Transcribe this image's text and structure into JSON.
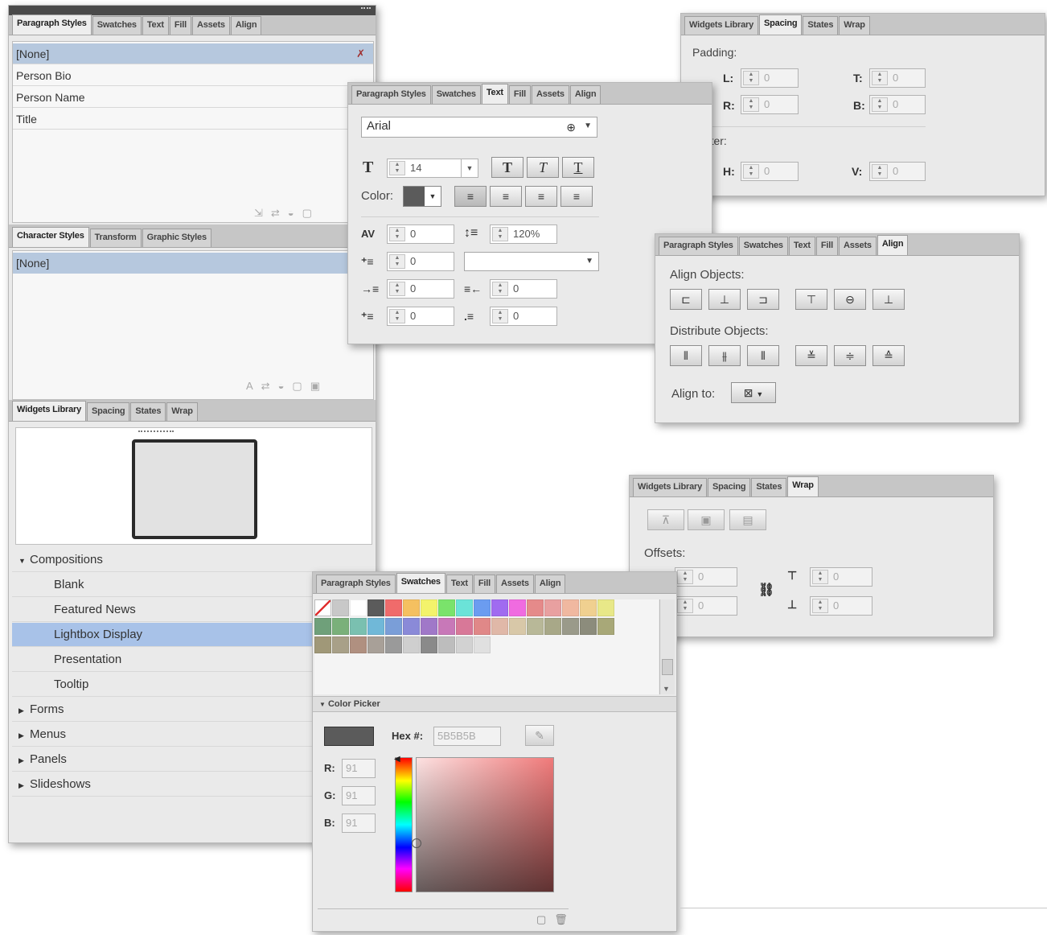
{
  "styles_panel": {
    "tabs": [
      "Paragraph Styles",
      "Swatches",
      "Text",
      "Fill",
      "Assets",
      "Align"
    ],
    "items": [
      "[None]",
      "Person Bio",
      "Person Name",
      "Title"
    ],
    "char_tabs": [
      "Character Styles",
      "Transform",
      "Graphic Styles"
    ],
    "char_items": [
      "[None]"
    ],
    "widget_tabs": [
      "Widgets Library",
      "Spacing",
      "States",
      "Wrap"
    ],
    "tree": {
      "group_open": "Compositions",
      "children": [
        "Blank",
        "Featured News",
        "Lightbox Display",
        "Presentation",
        "Tooltip"
      ],
      "groups_closed": [
        "Forms",
        "Menus",
        "Panels",
        "Slideshows"
      ]
    }
  },
  "text_panel": {
    "tabs": [
      "Paragraph Styles",
      "Swatches",
      "Text",
      "Fill",
      "Assets",
      "Align"
    ],
    "font": "Arial",
    "size": "14",
    "color_label": "Color:",
    "tracking": "0",
    "leading": "120%",
    "indent": "0",
    "left_margin": "0",
    "right_margin": "0",
    "space_before": "0",
    "space_after": "0",
    "style_glyphs": [
      "T",
      "T",
      "T"
    ]
  },
  "spacing_panel": {
    "tabs": [
      "Widgets Library",
      "Spacing",
      "States",
      "Wrap"
    ],
    "padding_label": "Padding:",
    "gutter_label": "Gutter:",
    "fields": {
      "L": "0",
      "T": "0",
      "R": "0",
      "B": "0",
      "H": "0",
      "V": "0"
    }
  },
  "align_panel": {
    "tabs": [
      "Paragraph Styles",
      "Swatches",
      "Text",
      "Fill",
      "Assets",
      "Align"
    ],
    "align_label": "Align Objects:",
    "distribute_label": "Distribute Objects:",
    "align_to_label": "Align to:"
  },
  "wrap_panel": {
    "tabs": [
      "Widgets Library",
      "Spacing",
      "States",
      "Wrap"
    ],
    "offsets_label": "Offsets:",
    "values": [
      "0",
      "0",
      "0",
      "0"
    ]
  },
  "swatches_panel": {
    "tabs": [
      "Paragraph Styles",
      "Swatches",
      "Text",
      "Fill",
      "Assets",
      "Align"
    ],
    "color_picker_label": "Color Picker",
    "hex_label": "Hex #:",
    "hex_value": "5B5B5B",
    "r_label": "R:",
    "r_value": "91",
    "g_label": "G:",
    "g_value": "91",
    "b_label": "B:",
    "b_value": "91",
    "current_color": "#5b5b5b",
    "swatch_rows": [
      [
        "#ffffff",
        "#c8c8c8",
        "#ffffff",
        "#5b5b5b",
        "#f06b6b",
        "#f5c060",
        "#f3f36b",
        "#7ae36b",
        "#6be3d8",
        "#6b9cf0",
        "#a06bf0",
        "#f06be0",
        "#e58a8a",
        "#e8a0a0",
        "#f0b8a0",
        "#f0d090",
        "#e8e888"
      ],
      [
        "#6fa07a",
        "#7ab07a",
        "#7ac0b0",
        "#70b8d8",
        "#7a9ed8",
        "#8a8ad8",
        "#a078c8",
        "#c878b8",
        "#d87898",
        "#e08888",
        "#e0b8a8",
        "#d8c8a8",
        "#b8b898",
        "#a8a888",
        "#9a9a8a",
        "#8c8c7c",
        "#a8a878"
      ],
      [
        "#a09878",
        "#a8a088",
        "#b09080",
        "#a8a098",
        "#9a9a9a",
        "#cfcfcf",
        "#8a8a8a",
        "#bdbdbd",
        "#d2d2d2",
        "#e0e0e0"
      ]
    ]
  }
}
